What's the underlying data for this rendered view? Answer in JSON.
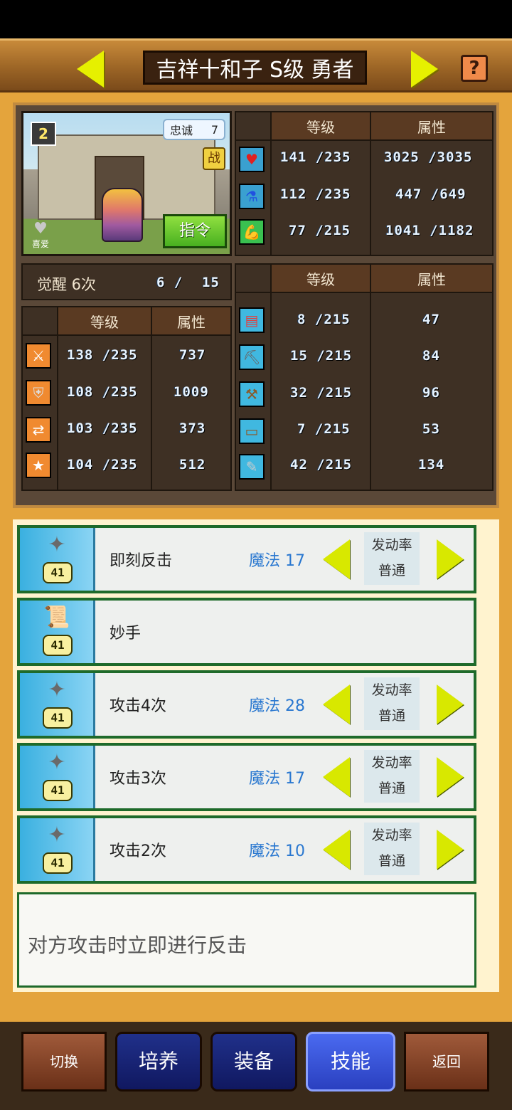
{
  "header": {
    "title": "吉祥十和子 S级 勇者",
    "help": "?"
  },
  "portrait": {
    "badge": "2",
    "loyalty_label": "忠诚",
    "loyalty_value": "7",
    "war": "战",
    "command": "指令",
    "favorite": "喜爱"
  },
  "stats_top": {
    "col_level": "等级",
    "col_attr": "属性",
    "rows": [
      {
        "icon": "heart-icon",
        "level": "141 /235",
        "attr": "3025 /3035"
      },
      {
        "icon": "potion-icon",
        "level": "112 /235",
        "attr": "447 /649"
      },
      {
        "icon": "muscle-icon",
        "level": "77 /215",
        "attr": "1041 /1182"
      }
    ]
  },
  "awaken": {
    "label": "觉醒 6次",
    "value": "6 /",
    "max": "15"
  },
  "stats_left": {
    "col_level": "等级",
    "col_attr": "属性",
    "rows": [
      {
        "icon": "sword-icon",
        "level": "138 /235",
        "attr": "737"
      },
      {
        "icon": "shield-icon",
        "level": "108 /235",
        "attr": "1009"
      },
      {
        "icon": "agility-icon",
        "level": "103 /235",
        "attr": "373"
      },
      {
        "icon": "star-icon",
        "level": "104 /235",
        "attr": "512"
      }
    ]
  },
  "stats_right": {
    "col_level": "等级",
    "col_attr": "属性",
    "rows": [
      {
        "icon": "book-icon",
        "level": "8 /215",
        "attr": "47"
      },
      {
        "icon": "pickaxe-icon",
        "level": "15 /215",
        "attr": "84"
      },
      {
        "icon": "shovel-icon",
        "level": "32 /215",
        "attr": "96"
      },
      {
        "icon": "craft-icon",
        "level": "7 /215",
        "attr": "53"
      },
      {
        "icon": "brush-icon",
        "level": "42 /215",
        "attr": "134"
      }
    ]
  },
  "skills": [
    {
      "name": "即刻反击",
      "magic": "魔法 17",
      "rate_label": "发动率",
      "rate": "普通",
      "lv": "41"
    },
    {
      "name": "妙手",
      "magic": "",
      "rate_label": "",
      "rate": "",
      "lv": "41"
    },
    {
      "name": "攻击4次",
      "magic": "魔法 28",
      "rate_label": "发动率",
      "rate": "普通",
      "lv": "41"
    },
    {
      "name": "攻击3次",
      "magic": "魔法 17",
      "rate_label": "发动率",
      "rate": "普通",
      "lv": "41"
    },
    {
      "name": "攻击2次",
      "magic": "魔法 10",
      "rate_label": "发动率",
      "rate": "普通",
      "lv": "41"
    }
  ],
  "description": "对方攻击时立即进行反击",
  "bottom_nav": {
    "switch": "切换",
    "train": "培养",
    "equip": "装备",
    "skills": "技能",
    "back": "返回"
  }
}
